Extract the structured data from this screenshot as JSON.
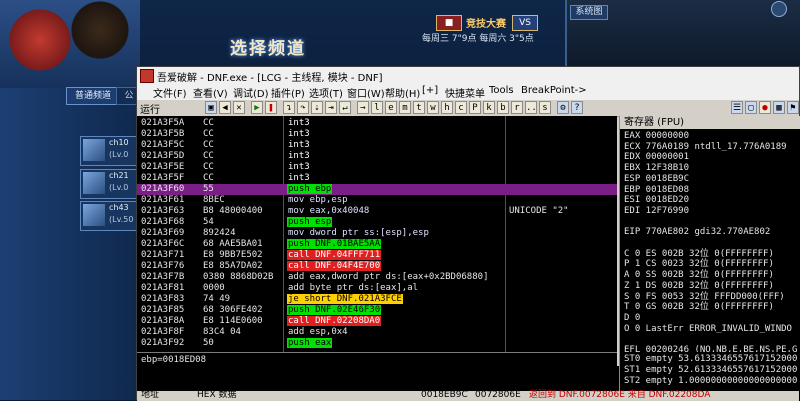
{
  "game": {
    "channel_title": "选择频道",
    "war_badge": "■",
    "war_text": "竞技大赛",
    "schedule": "每周三 7\"9点  每周六 3\"5点",
    "sysinfo_title": "系统图",
    "tab_normal": "普通频道",
    "tab_public": "公",
    "slots": [
      {
        "name": "ch10",
        "lv": "(Lv.0"
      },
      {
        "name": "ch21",
        "lv": "(Lv.0"
      },
      {
        "name": "ch43",
        "lv": "(Lv.50"
      }
    ]
  },
  "debugger": {
    "title": "吾爱破解 - DNF.exe - [LCG - 主线程, 模块 - DNF]",
    "menu": [
      "文件(F)",
      "查看(V)",
      "调试(D)",
      "插件(P)",
      "选项(T)",
      "窗口(W)",
      "帮助(H)",
      "[+]",
      "快捷菜单",
      "Tools",
      "BreakPoint->"
    ],
    "run_label": "运行",
    "toolbar_letters": [
      "l",
      "e",
      "m",
      "t",
      "w",
      "h",
      "c",
      "P",
      "k",
      "b",
      "r",
      "...",
      "s"
    ],
    "disasm": [
      {
        "addr": "021A3F5A",
        "hex": "CC",
        "asm": "int3",
        "kind": "int3",
        "cmt": ""
      },
      {
        "addr": "021A3F5B",
        "hex": "CC",
        "asm": "int3",
        "kind": "int3",
        "cmt": ""
      },
      {
        "addr": "021A3F5C",
        "hex": "CC",
        "asm": "int3",
        "kind": "int3",
        "cmt": ""
      },
      {
        "addr": "021A3F5D",
        "hex": "CC",
        "asm": "int3",
        "kind": "int3",
        "cmt": ""
      },
      {
        "addr": "021A3F5E",
        "hex": "CC",
        "asm": "int3",
        "kind": "int3",
        "cmt": ""
      },
      {
        "addr": "021A3F5F",
        "hex": "CC",
        "asm": "int3",
        "kind": "int3",
        "cmt": ""
      },
      {
        "addr": "021A3F60",
        "hex": "55",
        "asm": "push ebp",
        "kind": "push",
        "cmt": "",
        "selected": true
      },
      {
        "addr": "021A3F61",
        "hex": "8BEC",
        "asm": "mov ebp,esp",
        "kind": "mov",
        "cmt": ""
      },
      {
        "addr": "021A3F63",
        "hex": "B8 48000400",
        "asm": "mov eax,0x40048",
        "kind": "mov",
        "cmt": "UNICODE \"2\""
      },
      {
        "addr": "021A3F68",
        "hex": "54",
        "asm": "push esp",
        "kind": "push",
        "cmt": ""
      },
      {
        "addr": "021A3F69",
        "hex": "892424",
        "asm": "mov dword ptr ss:[esp],esp",
        "kind": "mov",
        "cmt": ""
      },
      {
        "addr": "021A3F6C",
        "hex": "68 AAE5BA01",
        "asm": "push DNF.01BAE5AA",
        "kind": "push",
        "cmt": ""
      },
      {
        "addr": "021A3F71",
        "hex": "E8 9BB7E502",
        "asm": "call DNF.04FFF711",
        "kind": "call",
        "cmt": ""
      },
      {
        "addr": "021A3F76",
        "hex": "E8 85A7DA02",
        "asm": "call DNF.04F4E700",
        "kind": "call",
        "cmt": ""
      },
      {
        "addr": "021A3F7B",
        "hex": "0380 8868D02B",
        "asm": "add eax,dword ptr ds:[eax+0x2BD06880]",
        "kind": "add",
        "cmt": ""
      },
      {
        "addr": "021A3F81",
        "hex": "0000",
        "asm": "add byte ptr ds:[eax],al",
        "kind": "add",
        "cmt": ""
      },
      {
        "addr": "021A3F83",
        "hex": "74 49",
        "asm": "je short DNF.021A3FCE",
        "kind": "jmp",
        "cmt": ""
      },
      {
        "addr": "021A3F85",
        "hex": "68 306FE402",
        "asm": "push DNF.02E46F30",
        "kind": "push",
        "cmt": ""
      },
      {
        "addr": "021A3F8A",
        "hex": "E8 114E0600",
        "asm": "call DNF.02208DA0",
        "kind": "call",
        "cmt": ""
      },
      {
        "addr": "021A3F8F",
        "hex": "83C4 04",
        "asm": "add esp,0x4",
        "kind": "add",
        "cmt": ""
      },
      {
        "addr": "021A3F92",
        "hex": "50",
        "asm": "push eax",
        "kind": "push",
        "cmt": ""
      }
    ],
    "info_line": "ebp=0018ED08",
    "registers_title": "寄存器 (FPU)",
    "registers": [
      "EAX 00000000",
      "ECX 776A0189 ntdll_17.776A0189",
      "EDX 00000001",
      "EBX 12F38B10",
      "ESP 0018EB9C",
      "EBP 0018ED08",
      "ESI 0018ED20",
      "EDI 12F76990",
      "",
      "EIP 770AE802 gdi32.770AE802",
      "",
      "C 0  ES 002B 32位 0(FFFFFFFF)",
      "P 1  CS 0023 32位 0(FFFFFFFF)",
      "A 0  SS 002B 32位 0(FFFFFFFF)",
      "Z 1  DS 002B 32位 0(FFFFFFFF)",
      "S 0  FS 0053 32位 FFFDD000(FFF)",
      "T 0  GS 002B 32位 0(FFFFFFFF)",
      "D 0",
      "O 0  LastErr ERROR_INVALID_WINDO",
      "",
      "EFL 00200246 (NO,NB,E,BE,NS,PE,G"
    ],
    "fpu": [
      "ST0 empty 53.6133346557617152000",
      "ST1 empty 52.6133346557617152000",
      "ST2 empty 1.00000000000000000000"
    ],
    "status": {
      "addr_label": "地址",
      "hex_label": "HEX 数据",
      "stack1": "0018EB9C",
      "stack2": "0072806E",
      "red1": "返回到 DNF.0072806E 来自 DNF.02208DA"
    }
  }
}
